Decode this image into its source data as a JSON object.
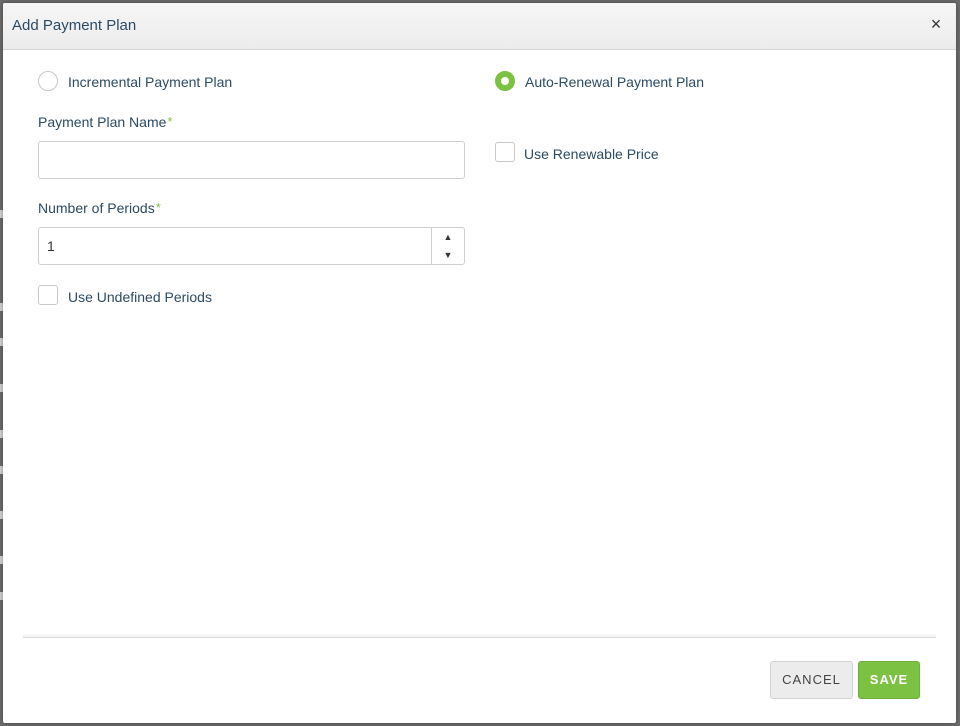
{
  "dialog": {
    "title": "Add Payment Plan",
    "close_glyph": "×"
  },
  "plan_type": {
    "options": [
      {
        "label": "Incremental Payment Plan",
        "checked": false
      },
      {
        "label": "Auto-Renewal Payment Plan",
        "checked": true
      }
    ]
  },
  "form": {
    "name_label": "Payment Plan Name",
    "name_value": "",
    "periods_label": "Number of Periods",
    "periods_value": "1",
    "required_marker": "*",
    "undefined_periods_label": "Use Undefined Periods",
    "undefined_periods_checked": false,
    "renewable_price_label": "Use Renewable Price",
    "renewable_price_checked": false
  },
  "icons": {
    "spin_up": "▲",
    "spin_down": "▼"
  },
  "footer": {
    "cancel_label": "CANCEL",
    "save_label": "SAVE"
  },
  "colors": {
    "accent": "#7cc242",
    "text": "#2c4a63"
  }
}
